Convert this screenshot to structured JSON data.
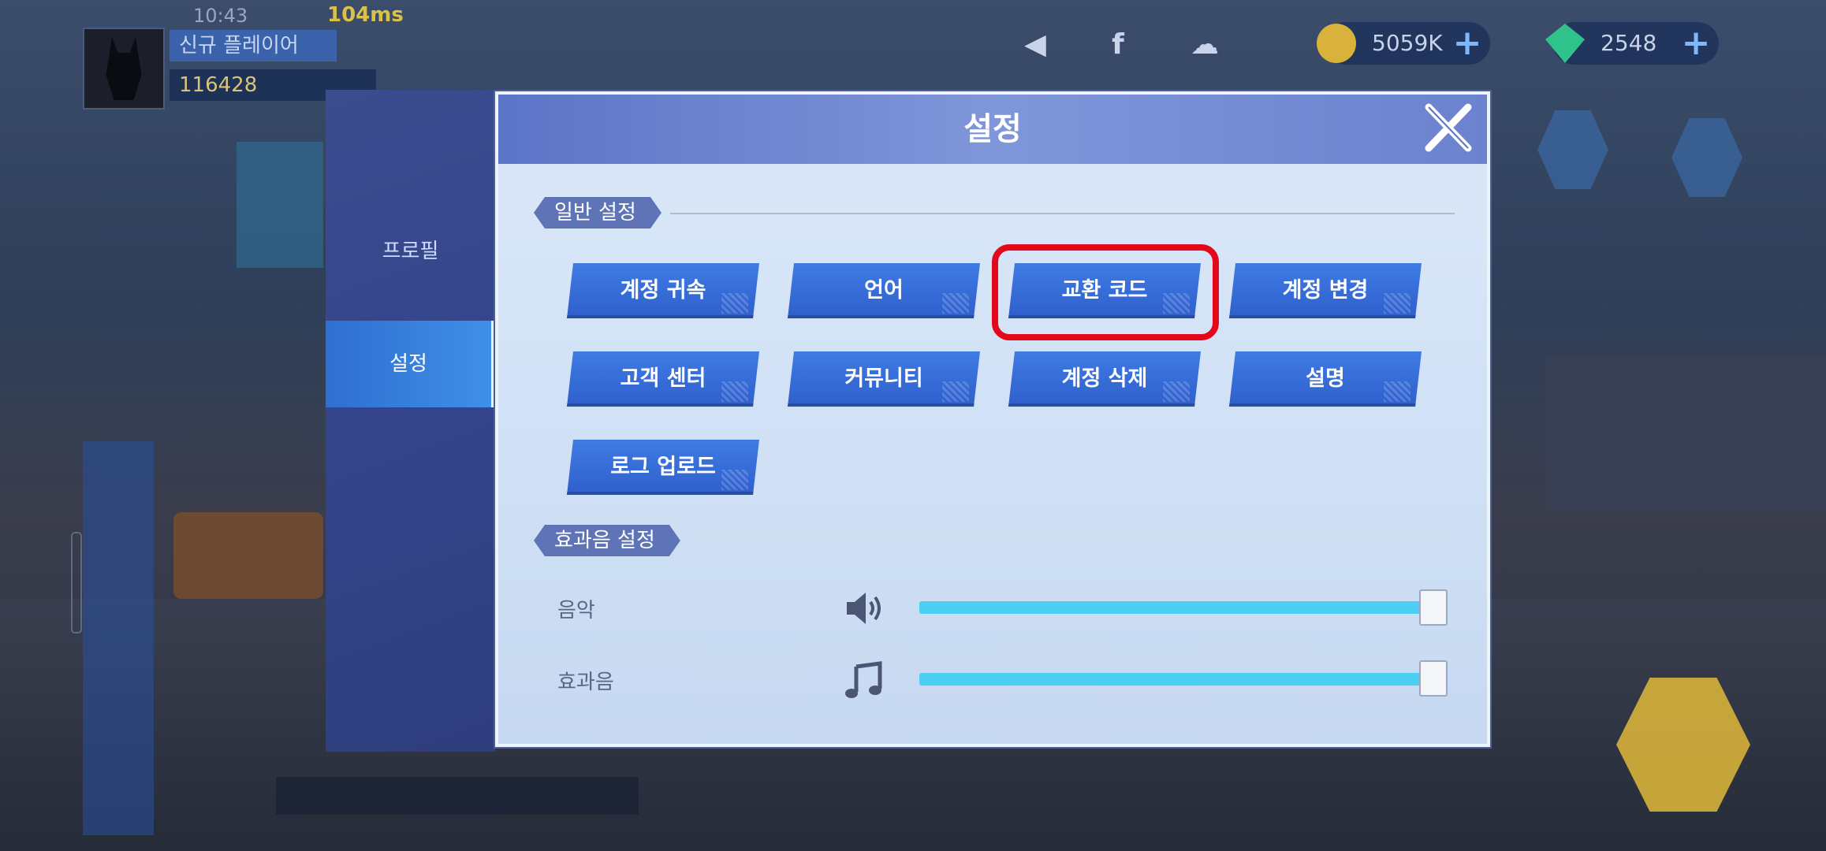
{
  "hud": {
    "time": "10:43",
    "ping": "104ms",
    "player_name": "신규 플레이어",
    "player_coins": "116428",
    "gold": "5059K",
    "gems": "2548"
  },
  "side_menu": {
    "items": [
      {
        "label": "프로필",
        "active": false
      },
      {
        "label": "설정",
        "active": true
      }
    ]
  },
  "dialog": {
    "title": "설정",
    "general_section": "일반 설정",
    "buttons": [
      {
        "label": "계정 귀속"
      },
      {
        "label": "언어"
      },
      {
        "label": "교환 코드",
        "highlighted": true
      },
      {
        "label": "계정 변경"
      },
      {
        "label": "고객 센터"
      },
      {
        "label": "커뮤니티"
      },
      {
        "label": "계정 삭제"
      },
      {
        "label": "설명"
      },
      {
        "label": "로그 업로드"
      }
    ],
    "sound_section": "효과음 설정",
    "sliders": [
      {
        "label": "음악",
        "icon": "speaker-icon",
        "value": 1.0
      },
      {
        "label": "효과음",
        "icon": "music-note-icon",
        "value": 1.0
      }
    ]
  },
  "colors": {
    "accent": "#2f5fcc",
    "highlight": "#e3081a",
    "slider": "#4bd0f4"
  }
}
